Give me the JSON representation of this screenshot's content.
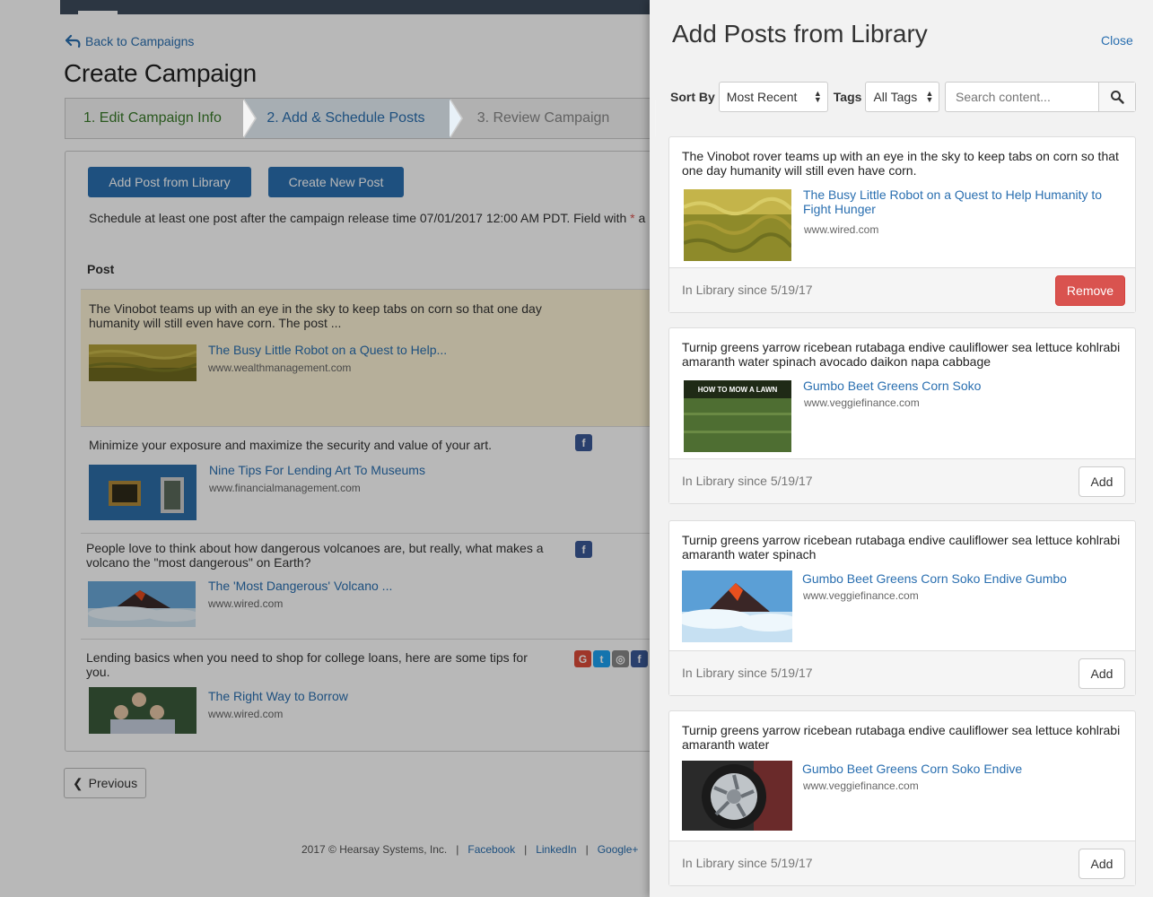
{
  "background": {
    "back_link": "Back to Campaigns",
    "page_title": "Create Campaign",
    "steps": [
      "1. Edit Campaign Info",
      "2. Add & Schedule Posts",
      "3. Review Campaign"
    ],
    "add_from_library": "Add Post from Library",
    "create_new_post": "Create New Post",
    "schedule_note": "Schedule at least one post after the campaign release time 07/01/2017 12:00 AM PDT. Field with ",
    "required_mark": "*",
    "schedule_note_tail": " a",
    "post_column": "Post",
    "posts": [
      {
        "text": "The Vinobot teams up with an eye in the sky to keep tabs on corn so that one day humanity will still even have corn. The post ...",
        "title": "The Busy Little Robot on a Quest to Help...",
        "source": "www.wealthmanagement.com",
        "networks": []
      },
      {
        "text": "Minimize your exposure and maximize the security and value of your art.",
        "title": "Nine Tips For Lending Art To Museums",
        "source": "www.financialmanagement.com",
        "networks": [
          "facebook"
        ]
      },
      {
        "text": "People love to think about how dangerous volcanoes are, but really, what makes a volcano the \"most dangerous\" on Earth?",
        "title": "The 'Most Dangerous' Volcano ...",
        "source": "www.wired.com",
        "networks": [
          "facebook"
        ]
      },
      {
        "text": "Lending basics when you need to shop for college loans, here are some tips for you.",
        "title": "The Right Way to Borrow",
        "source": "www.wired.com",
        "networks": [
          "google-plus",
          "twitter",
          "web",
          "facebook"
        ]
      }
    ],
    "previous": "Previous",
    "footer": {
      "copyright": "2017 © Hearsay Systems, Inc.",
      "links": [
        "Facebook",
        "LinkedIn",
        "Google+"
      ],
      "separator": "|"
    }
  },
  "drawer": {
    "title": "Add Posts from Library",
    "close": "Close",
    "sort_label": "Sort By",
    "sort_value": "Most Recent",
    "tags_label": "Tags",
    "tags_value": "All Tags",
    "search_placeholder": "Search content...",
    "cards": [
      {
        "text": "The Vinobot rover teams up with an eye in the sky to keep tabs on corn so that one day humanity will still even have corn.",
        "title": "The Busy Little Robot on a Quest to Help Humanity to Fight Hunger",
        "source": "www.wired.com",
        "since": "In Library since 5/19/17",
        "action": "Remove"
      },
      {
        "text": "Turnip greens yarrow ricebean rutabaga endive cauliflower sea lettuce kohlrabi amaranth water spinach avocado daikon napa cabbage",
        "title": "Gumbo Beet Greens Corn Soko",
        "source": "www.veggiefinance.com",
        "since": "In Library since 5/19/17",
        "action": "Add",
        "thumb_caption": "HOW TO MOW A LAWN"
      },
      {
        "text": "Turnip greens yarrow ricebean rutabaga endive cauliflower sea lettuce kohlrabi amaranth water spinach",
        "title": "Gumbo Beet Greens Corn Soko Endive Gumbo",
        "source": "www.veggiefinance.com",
        "since": "In Library since 5/19/17",
        "action": "Add"
      },
      {
        "text": "Turnip greens yarrow ricebean rutabaga endive cauliflower sea lettuce kohlrabi amaranth water",
        "title": "Gumbo Beet Greens Corn Soko Endive",
        "source": "www.veggiefinance.com",
        "since": "In Library since 5/19/17",
        "action": "Add"
      }
    ]
  },
  "colors": {
    "link": "#2a6fb0",
    "primary": "#2a6fb0",
    "danger": "#d9534f",
    "step_done": "#3a7a2a",
    "highlight_row": "#fdf3d6",
    "facebook": "#3b5998"
  }
}
